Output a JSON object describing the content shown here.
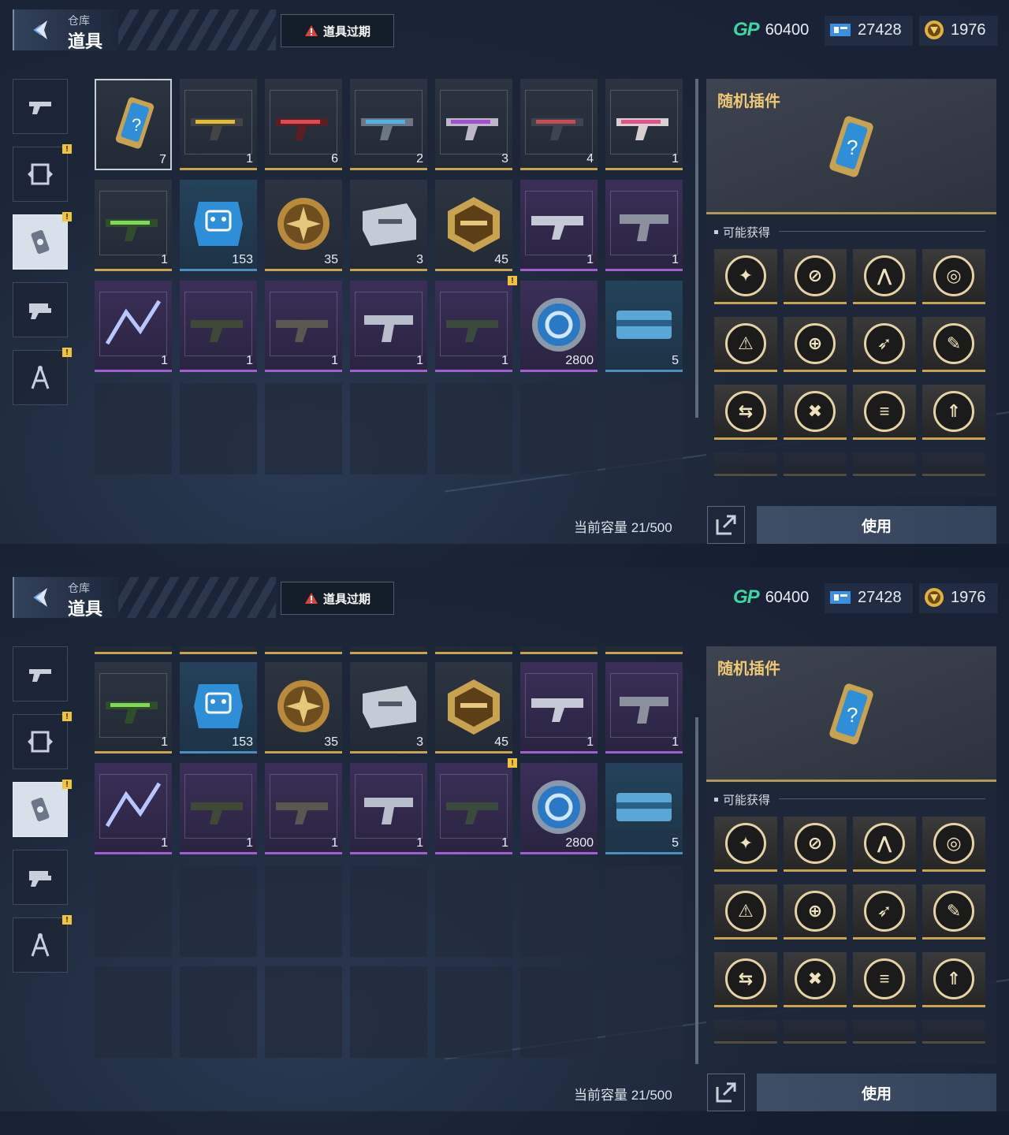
{
  "header": {
    "breadcrumb_small": "仓库",
    "title": "道具",
    "expire_button": "道具过期",
    "currency": {
      "gp_icon": "GP",
      "gp": "60400",
      "ticket": "27428",
      "coin": "1976"
    }
  },
  "sidebar": {
    "tabs": [
      {
        "name": "weapon-tab-icon",
        "alert": false,
        "active": false
      },
      {
        "name": "parts-tab-icon",
        "alert": true,
        "active": false
      },
      {
        "name": "item-tab-icon",
        "alert": true,
        "active": true
      },
      {
        "name": "attachment-tab-icon",
        "alert": false,
        "active": false
      },
      {
        "name": "blueprint-tab-icon",
        "alert": true,
        "active": false
      }
    ],
    "alert_glyph": "!"
  },
  "inventory": {
    "top_rows": [
      [
        "7",
        "1",
        "6",
        "2",
        "3",
        "4",
        "1"
      ],
      [
        "1",
        "153",
        "35",
        "3",
        "45",
        "1",
        "1"
      ],
      [
        "1",
        "1",
        "1",
        "1",
        "1",
        "2800",
        "5"
      ]
    ],
    "capacity": "当前容量 21/500"
  },
  "detail": {
    "title": "随机插件",
    "section": "可能获得",
    "mods": [
      "✦",
      "⊘",
      "⋀",
      "◎",
      "⚠",
      "⊕",
      "➶",
      "✎",
      "⇆",
      "✖",
      "≡",
      "⇑"
    ],
    "use_button": "使用"
  }
}
